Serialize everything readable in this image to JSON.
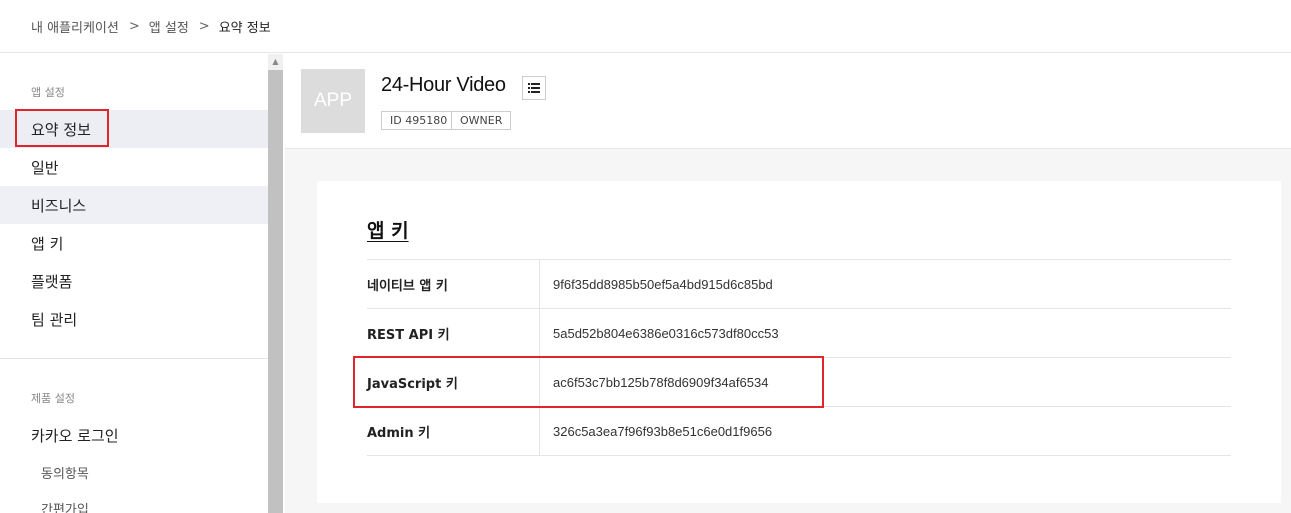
{
  "breadcrumb": {
    "items": [
      "내 애플리케이션",
      "앱 설정",
      "요약 정보"
    ],
    "separator": ">"
  },
  "sidebar": {
    "app_section_title": "앱 설정",
    "app_items": [
      "요약 정보",
      "일반",
      "비즈니스",
      "앱 키",
      "플랫폼",
      "팀 관리"
    ],
    "product_section_title": "제품 설정",
    "product_items": [
      "카카오 로그인"
    ],
    "product_subitems": [
      "동의항목",
      "간편가입"
    ]
  },
  "app": {
    "thumbnail_text": "APP",
    "name": "24-Hour Video",
    "id_tag": "ID 495180",
    "role_tag": "OWNER"
  },
  "app_keys": {
    "title": "앱 키",
    "rows": [
      {
        "label": "네이티브 앱 키",
        "value": "9f6f35dd8985b50ef5a4bd915d6c85bd"
      },
      {
        "label": "REST API 키",
        "value": "5a5d52b804e6386e0316c573df80cc53"
      },
      {
        "label": "JavaScript 키",
        "value": "ac6f53c7bb125b78f8d6909f34af6534"
      },
      {
        "label": "Admin 키",
        "value": "326c5a3ea7f96f93b8e51c6e0d1f9656"
      }
    ]
  },
  "colors": {
    "highlight_border": "#e0252b",
    "active_bg": "#eceef4",
    "thumb_bg": "#dcdcdc"
  },
  "icons": {
    "list_button": "list-icon",
    "scroll_up": "scroll-up-arrow-icon"
  }
}
